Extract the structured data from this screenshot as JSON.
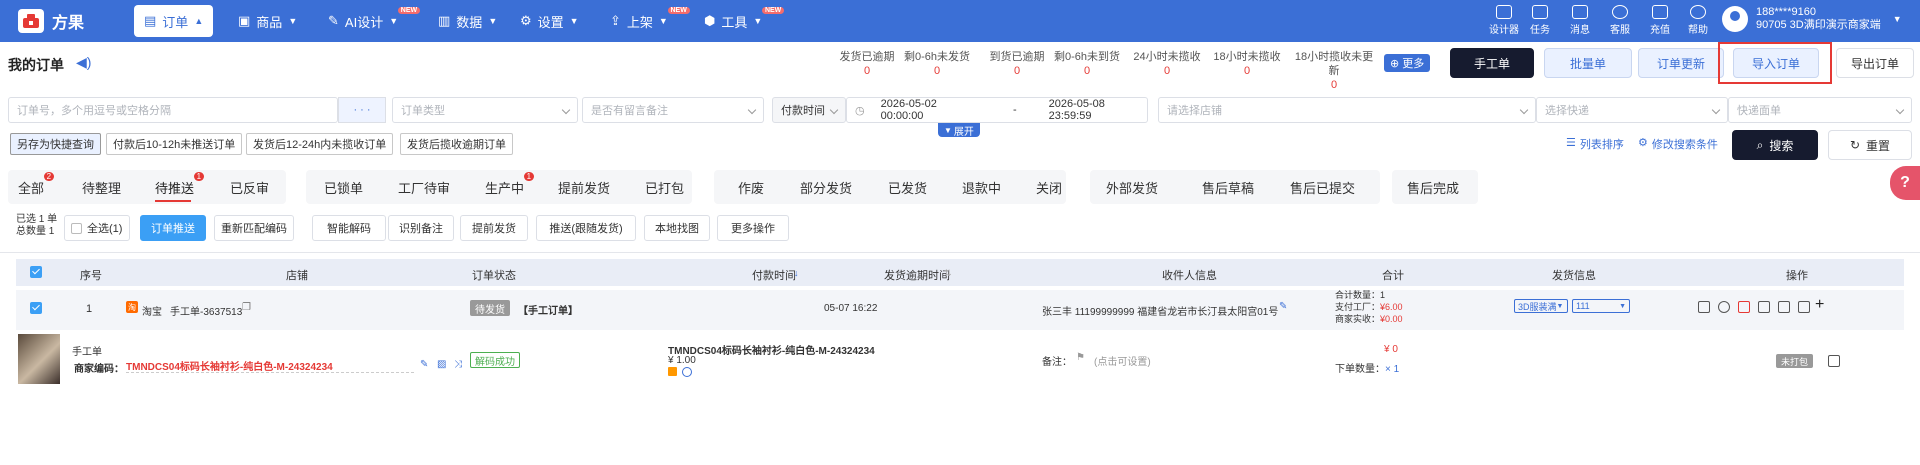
{
  "brand": {
    "name": "方果"
  },
  "nav": [
    {
      "label": "订单",
      "icon": "order-icon",
      "active": true
    },
    {
      "label": "商品",
      "icon": "product-icon"
    },
    {
      "label": "AI设计",
      "icon": "ai-design-icon",
      "badge": "NEW"
    },
    {
      "label": "数据",
      "icon": "chart-icon"
    },
    {
      "label": "设置",
      "icon": "gear-icon"
    },
    {
      "label": "上架",
      "icon": "upload-icon",
      "badge": "NEW"
    },
    {
      "label": "工具",
      "icon": "tool-icon",
      "badge": "NEW"
    }
  ],
  "utility": [
    {
      "label": "设计器"
    },
    {
      "label": "任务"
    },
    {
      "label": "消息"
    },
    {
      "label": "客服"
    },
    {
      "label": "充值"
    },
    {
      "label": "帮助"
    }
  ],
  "user": {
    "phone": "188****9160",
    "store": "90705 3D满印演示商家端"
  },
  "page": {
    "title": "我的订单"
  },
  "stats": [
    {
      "label": "发货已逾期",
      "value": "0"
    },
    {
      "label": "剩0-6h未发货",
      "value": "0"
    },
    {
      "label": "到货已逾期",
      "value": "0"
    },
    {
      "label": "剩0-6h未到货",
      "value": "0"
    },
    {
      "label": "24小时未揽收",
      "value": "0"
    },
    {
      "label": "18小时未揽收",
      "value": "0"
    },
    {
      "label": "18小时揽收未更新",
      "value": "0"
    }
  ],
  "more_label": "更多",
  "actions": {
    "manual": "手工单",
    "batch": "批量单",
    "update": "订单更新",
    "import": "导入订单",
    "export": "导出订单"
  },
  "filters": {
    "order_no": "订单号，多个用逗号或空格分隔",
    "dots": "· · ·",
    "order_type": "订单类型",
    "remark": "是否有留言备注",
    "time_type": "付款时间",
    "date_start": "2026-05-02 00:00:00",
    "date_sep": "-",
    "date_end": "2026-05-08 23:59:59",
    "shop": "请选择店铺",
    "express": "选择快递",
    "waybill": "快递面单",
    "expand": "展开"
  },
  "quick": {
    "save": "另存为快捷查询",
    "tags": [
      "付款后10-12h未推送订单",
      "发货后12-24h内未揽收订单",
      "发货后揽收逾期订单"
    ]
  },
  "right_tools": {
    "sort": "列表排序",
    "modify": "修改搜索条件",
    "search": "搜索",
    "reset": "重置"
  },
  "tabs": [
    {
      "label": "全部",
      "badge": "2"
    },
    {
      "label": "待整理"
    },
    {
      "label": "待推送",
      "badge": "1"
    },
    {
      "label": "已反审"
    },
    {
      "label": "已锁单"
    },
    {
      "label": "工厂待审"
    },
    {
      "label": "生产中",
      "badge": "1"
    },
    {
      "label": "提前发货"
    },
    {
      "label": "已打包"
    },
    {
      "label": "作废"
    },
    {
      "label": "部分发货"
    },
    {
      "label": "已发货"
    },
    {
      "label": "退款中"
    },
    {
      "label": "关闭"
    },
    {
      "label": "外部发货"
    },
    {
      "label": "售后草稿"
    },
    {
      "label": "售后已提交"
    },
    {
      "label": "售后完成"
    }
  ],
  "selection": {
    "line1": "已选 1 单",
    "line2": "总数量 1",
    "select_all": "全选(1)"
  },
  "action_buttons": [
    "订单推送",
    "重新匹配编码",
    "智能解码",
    "识别备注",
    "提前发货",
    "推送(跟随发货)",
    "本地找图",
    "更多操作"
  ],
  "columns": [
    "序号",
    "店铺",
    "订单状态",
    "付款时间",
    "发货逾期时间",
    "收件人信息",
    "合计",
    "发货信息",
    "操作"
  ],
  "order": {
    "index": "1",
    "platform": "淘宝",
    "shop": "手工单-3637513",
    "status": "待发货",
    "type": "【手工订单】",
    "paid": "05-07 16:22",
    "recipient": "张三丰  11199999999  福建省龙岩市长汀县太阳宫01号",
    "total_qty_label": "合计数量：",
    "total_qty": "1",
    "pay_factory_label": "支付工厂：",
    "pay_factory": "¥6.00",
    "merchant_label": "商家实收：",
    "merchant": "¥0.00",
    "ship_sel1": "3D服装满",
    "ship_sel2": "111"
  },
  "item": {
    "kind": "手工单",
    "code_label": "商家编码：",
    "code": "TMNDCS04标码长袖衬衫-纯白色-M-24324234",
    "decode": "解码成功",
    "title": "TMNDCS04标码长袖衬衫-纯白色-M-24324234",
    "price": "¥ 1.00",
    "remark_label": "备注：",
    "remark_hint": "(点击可设置)",
    "amount": "¥ 0",
    "order_qty_label": "下单数量：",
    "order_qty": "× 1",
    "pack": "未打包"
  },
  "colors": {
    "primary": "#3b6fd6",
    "danger": "#e53935",
    "highlight_border": "#e53935",
    "dark_button": "#161b2f"
  }
}
